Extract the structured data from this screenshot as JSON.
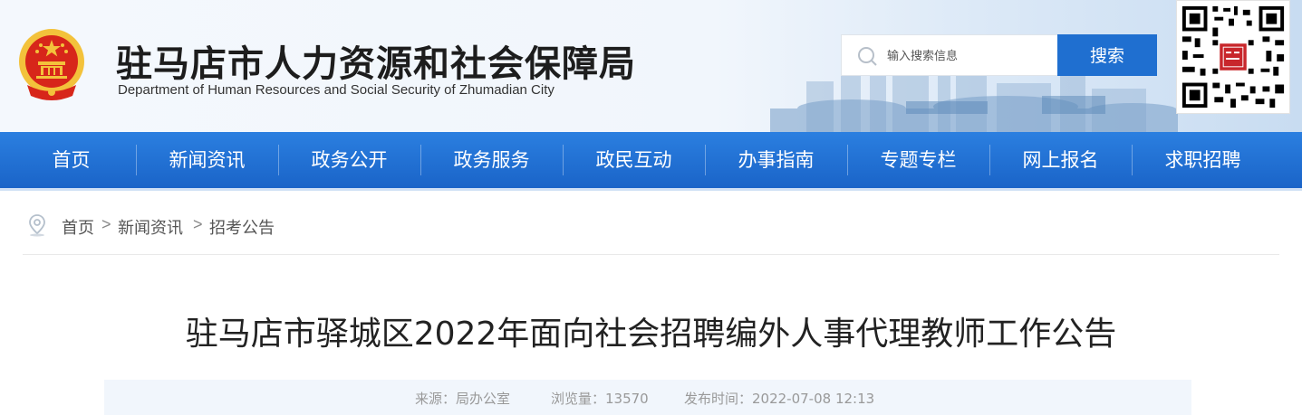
{
  "header": {
    "title": "驻马店市人力资源和社会保障局",
    "subtitle": "Department of Human Resources and Social Security of Zhumadian City",
    "search": {
      "placeholder": "输入搜索信息",
      "button_label": "搜索"
    },
    "qr_code": {
      "icon": "qr-code",
      "badge_icon": "seal-stamp"
    },
    "emblem_icon": "national-emblem"
  },
  "nav": {
    "items": [
      "首页",
      "新闻资讯",
      "政务公开",
      "政务服务",
      "政民互动",
      "办事指南",
      "专题专栏",
      "网上报名",
      "求职招聘"
    ]
  },
  "breadcrumb": {
    "icon": "location-pin",
    "items": [
      "首页",
      "新闻资讯",
      "招考公告"
    ],
    "separator": ">"
  },
  "article": {
    "title": "驻马店市驿城区2022年面向社会招聘编外人事代理教师工作公告",
    "source": "来源：局办公室",
    "views": "浏览量：13570",
    "published": "发布时间：2022-07-08 12:13"
  },
  "colors": {
    "nav_bg": "#1f6fd0",
    "search_button": "#1f6fd0",
    "meta_bar": "#f1f6fc",
    "emblem_red": "#d7261a",
    "emblem_gold": "#f3c23b"
  }
}
